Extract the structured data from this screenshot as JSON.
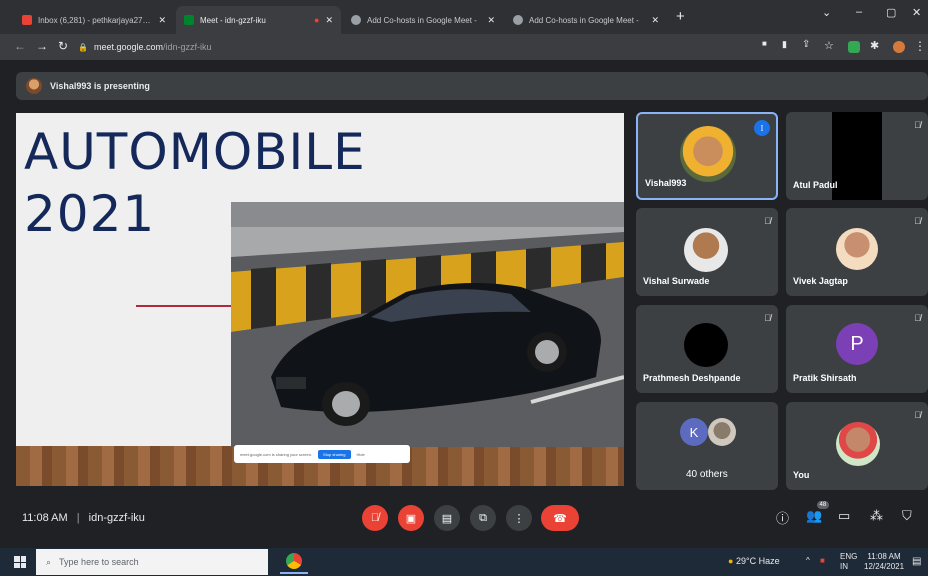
{
  "browser": {
    "tabs": [
      {
        "title": "Inbox (6,281) - pethkarjaya274@g",
        "active": false,
        "fav_color": "#ea4335"
      },
      {
        "title": "Meet - idn-gzzf-iku",
        "active": true,
        "fav_color": "#00832d"
      },
      {
        "title": "",
        "active": false,
        "fav_color": "#ea4335"
      },
      {
        "title": "Add Co-hosts in Google Meet -",
        "active": false,
        "fav_color": "#9aa0a6"
      },
      {
        "title": "Add Co-hosts in Google Meet -",
        "active": false,
        "fav_color": "#9aa0a6"
      }
    ],
    "url_host": "meet.google.com",
    "url_path": "/idn-gzzf-iku"
  },
  "banner": {
    "text": "Vishal993 is presenting"
  },
  "slide": {
    "title_line1": "AUTOMOBILE",
    "title_line2": "2021",
    "share_text": "meet.google.com is sharing your screen.",
    "stop_label": "Stop sharing",
    "hide_label": "Hide"
  },
  "participants": [
    {
      "name": "Vishal993",
      "avatar": "photo",
      "speaking": true
    },
    {
      "name": "Atul Padul",
      "avatar": "video-black"
    },
    {
      "name": "Vishal Surwade",
      "avatar": "photo"
    },
    {
      "name": "Vivek Jagtap",
      "avatar": "photo"
    },
    {
      "name": "Prathmesh Deshpande",
      "avatar": "black"
    },
    {
      "name": "Pratik Shirsath",
      "avatar": "letter",
      "letter": "P",
      "color": "#7b3fb6"
    },
    {
      "name": "40 others",
      "avatar": "group",
      "letter": "K",
      "color": "#5c6bc0"
    },
    {
      "name": "You",
      "avatar": "photo"
    }
  ],
  "meeting": {
    "time": "11:08 AM",
    "code": "idn-gzzf-iku",
    "people_count": "48",
    "end_color": "#ea4335"
  },
  "taskbar": {
    "search_placeholder": "Type here to search",
    "weather": "29°C Haze",
    "lang1": "ENG",
    "lang2": "IN",
    "time": "11:08 AM",
    "date": "12/24/2021"
  }
}
